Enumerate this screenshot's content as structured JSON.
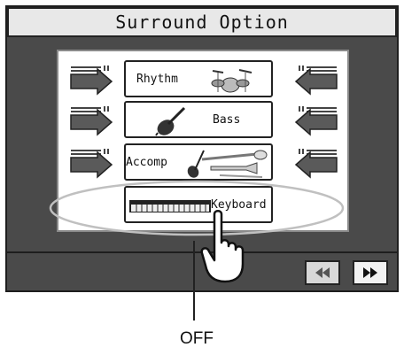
{
  "screen": {
    "title": "Surround Option",
    "parts": [
      {
        "label": "Rhythm",
        "icon": "drum-kit-icon"
      },
      {
        "label": "Bass",
        "icon": "contrabass-icon"
      },
      {
        "label": "Accomp",
        "icon": "orchestra-instruments-icon"
      },
      {
        "label": "Keyboard",
        "icon": "keyboard-icon"
      }
    ],
    "nav": {
      "prev_icon": "rewind-icon",
      "next_icon": "fast-forward-icon"
    }
  },
  "callout": {
    "label": "OFF"
  }
}
